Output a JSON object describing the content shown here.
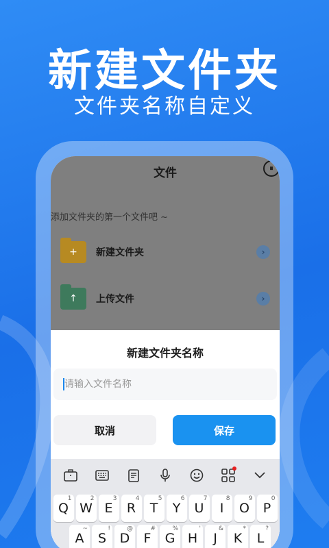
{
  "promo": {
    "headline": "新建文件夹",
    "subline": "文件夹名称自定义"
  },
  "app": {
    "title": "文件",
    "top_icon_text": "⏸",
    "hint": "添加文件夹的第一个文件吧 ~",
    "rows": [
      {
        "label": "新建文件夹",
        "icon": "folder-add-icon",
        "icon_glyph": "+",
        "color": "#b78a22"
      },
      {
        "label": "上传文件",
        "icon": "folder-upload-icon",
        "icon_glyph": "↑",
        "color": "#3e7a5c"
      }
    ]
  },
  "dialog": {
    "title": "新建文件夹名称",
    "input_placeholder": "请输入文件名称",
    "cancel_label": "取消",
    "save_label": "保存"
  },
  "keyboard": {
    "toolbar": [
      "briefcase-icon",
      "keyboard-icon",
      "clipboard-icon",
      "mic-icon",
      "emoji-icon",
      "grid-icon",
      "chevron-down-icon"
    ],
    "row1": [
      {
        "key": "Q",
        "num": "1"
      },
      {
        "key": "W",
        "num": "2"
      },
      {
        "key": "E",
        "num": "3"
      },
      {
        "key": "R",
        "num": "4"
      },
      {
        "key": "T",
        "num": "5"
      },
      {
        "key": "Y",
        "num": "6"
      },
      {
        "key": "U",
        "num": "7"
      },
      {
        "key": "I",
        "num": "8"
      },
      {
        "key": "O",
        "num": "9"
      },
      {
        "key": "P",
        "num": "0"
      }
    ],
    "row2": [
      {
        "key": "A",
        "num": "~"
      },
      {
        "key": "S",
        "num": "!"
      },
      {
        "key": "D",
        "num": "@"
      },
      {
        "key": "F",
        "num": "#"
      },
      {
        "key": "G",
        "num": "%"
      },
      {
        "key": "H",
        "num": "'"
      },
      {
        "key": "J",
        "num": "&"
      },
      {
        "key": "K",
        "num": "*"
      },
      {
        "key": "L",
        "num": "?"
      }
    ]
  },
  "colors": {
    "background": "#1a6fe8",
    "accent": "#1a92f0",
    "notification_dot": "#e62020"
  }
}
